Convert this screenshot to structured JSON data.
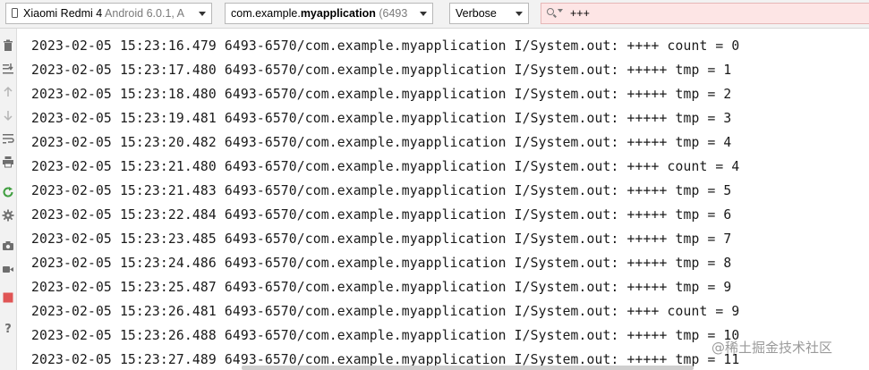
{
  "toolbar": {
    "device": {
      "name": "Xiaomi Redmi 4",
      "detail": "Android 6.0.1, A"
    },
    "process": {
      "prefix": "com.example.",
      "app": "myapplication",
      "pid": "(6493"
    },
    "log_level": "Verbose",
    "search": {
      "value": "+++"
    }
  },
  "gutter_icons": [
    "trash-icon",
    "scroll-to-end-icon",
    "up-arrow-icon",
    "down-arrow-icon",
    "soft-wrap-icon",
    "print-icon",
    "restart-icon",
    "settings-icon",
    "screenshot-icon",
    "screen-record-icon",
    "stop-icon",
    "help-icon"
  ],
  "colors": {
    "search_error_bg": "#fde5e5",
    "stop_red": "#e05555",
    "restart_green": "#3f9e3f"
  },
  "log_lines": [
    {
      "date": "2023-02-05",
      "time": "15:23:16.479",
      "pid": "6493-6570/com.example.myapplication",
      "tag": "I/System.out:",
      "msg": "++++ count = 0"
    },
    {
      "date": "2023-02-05",
      "time": "15:23:17.480",
      "pid": "6493-6570/com.example.myapplication",
      "tag": "I/System.out:",
      "msg": "+++++ tmp = 1"
    },
    {
      "date": "2023-02-05",
      "time": "15:23:18.480",
      "pid": "6493-6570/com.example.myapplication",
      "tag": "I/System.out:",
      "msg": "+++++ tmp = 2"
    },
    {
      "date": "2023-02-05",
      "time": "15:23:19.481",
      "pid": "6493-6570/com.example.myapplication",
      "tag": "I/System.out:",
      "msg": "+++++ tmp = 3"
    },
    {
      "date": "2023-02-05",
      "time": "15:23:20.482",
      "pid": "6493-6570/com.example.myapplication",
      "tag": "I/System.out:",
      "msg": "+++++ tmp = 4"
    },
    {
      "date": "2023-02-05",
      "time": "15:23:21.480",
      "pid": "6493-6570/com.example.myapplication",
      "tag": "I/System.out:",
      "msg": "++++ count = 4"
    },
    {
      "date": "2023-02-05",
      "time": "15:23:21.483",
      "pid": "6493-6570/com.example.myapplication",
      "tag": "I/System.out:",
      "msg": "+++++ tmp = 5"
    },
    {
      "date": "2023-02-05",
      "time": "15:23:22.484",
      "pid": "6493-6570/com.example.myapplication",
      "tag": "I/System.out:",
      "msg": "+++++ tmp = 6"
    },
    {
      "date": "2023-02-05",
      "time": "15:23:23.485",
      "pid": "6493-6570/com.example.myapplication",
      "tag": "I/System.out:",
      "msg": "+++++ tmp = 7"
    },
    {
      "date": "2023-02-05",
      "time": "15:23:24.486",
      "pid": "6493-6570/com.example.myapplication",
      "tag": "I/System.out:",
      "msg": "+++++ tmp = 8"
    },
    {
      "date": "2023-02-05",
      "time": "15:23:25.487",
      "pid": "6493-6570/com.example.myapplication",
      "tag": "I/System.out:",
      "msg": "+++++ tmp = 9"
    },
    {
      "date": "2023-02-05",
      "time": "15:23:26.481",
      "pid": "6493-6570/com.example.myapplication",
      "tag": "I/System.out:",
      "msg": "++++ count = 9"
    },
    {
      "date": "2023-02-05",
      "time": "15:23:26.488",
      "pid": "6493-6570/com.example.myapplication",
      "tag": "I/System.out:",
      "msg": "+++++ tmp = 10"
    },
    {
      "date": "2023-02-05",
      "time": "15:23:27.489",
      "pid": "6493-6570/com.example.myapplication",
      "tag": "I/System.out:",
      "msg": "+++++ tmp = 11"
    }
  ],
  "watermark": "@稀土掘金技术社区"
}
